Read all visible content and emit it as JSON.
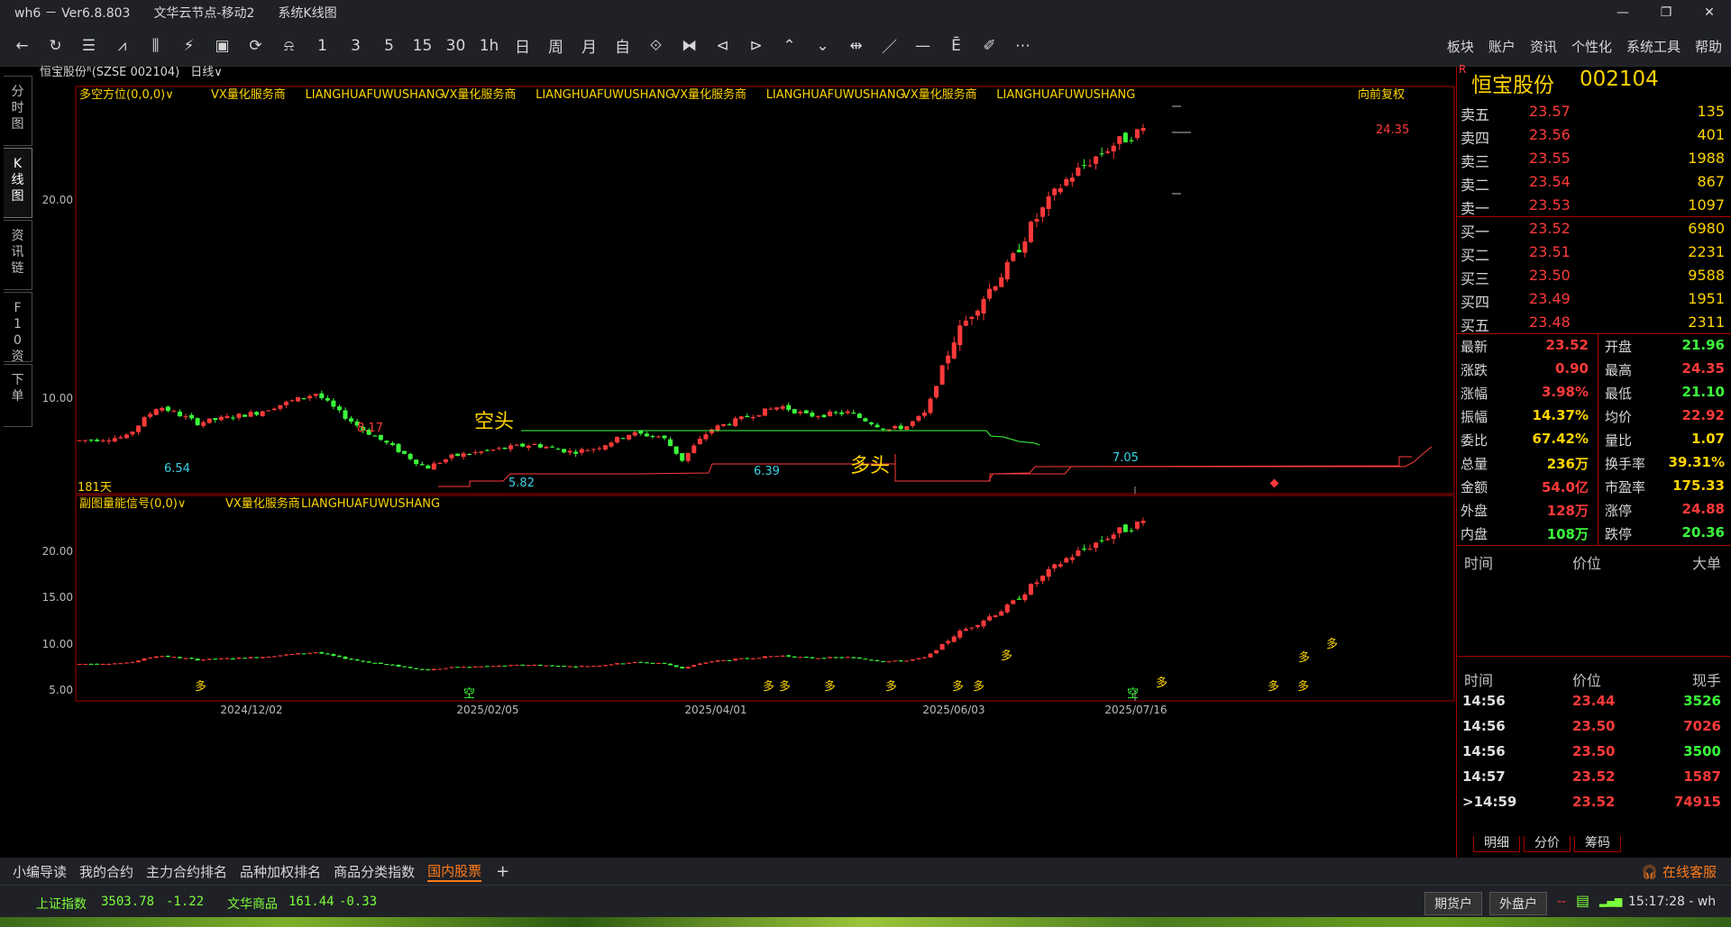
{
  "titlebar": {
    "app": "wh6 － Ver6.8.803",
    "node": "文华云节点-移动2",
    "view": "系统K线图",
    "ctrls": [
      "—",
      "❐",
      "✕"
    ]
  },
  "toolbar": {
    "icons": [
      "←",
      "↻",
      "☰",
      "⩘",
      "⫼",
      "⚡",
      "▣",
      "⟳",
      "⍾",
      "1",
      "3",
      "5",
      "15",
      "30",
      "1h",
      "日",
      "周",
      "月",
      "自",
      "⟐",
      "⧓",
      "⊲",
      "⊳",
      "⌃",
      "⌄",
      "⇹",
      "／",
      "—",
      "Ē",
      "✐",
      "⋯"
    ],
    "menu": [
      "板块",
      "账户",
      "资讯",
      "个性化",
      "系统工具",
      "帮助"
    ]
  },
  "sidetabs": [
    "分时图",
    "K线图",
    "资讯链",
    "F10资料",
    "下单"
  ],
  "chart": {
    "symbol_line": "恒宝股份ᴿ(SZSE 002104)",
    "period": "日线",
    "main_indicator": "多空方位(0,0,0)",
    "main_tags": [
      "VX量化服务商",
      "LIANGHUAFUWUSHANG",
      "VX量化服务商",
      "LIANGHUAFUWUSHANG",
      "VX量化服务商",
      "LIANGHUAFUWUSHANG",
      "VX量化服务商",
      "LIANGHUAFUWUSHANG"
    ],
    "adjust": "向前复权",
    "days": "181天",
    "main_yticks": [
      "20.00",
      "10.00"
    ],
    "sub_indicator": "副图量能信号(0,0)",
    "sub_tags": [
      "VX量化服务商",
      "LIANGHUAFUWUSHANG"
    ],
    "sub_yticks": [
      "20.00",
      "15.00",
      "10.00",
      "5.00"
    ],
    "dates": [
      "2024/12/02",
      "2025/02/05",
      "2025/04/01",
      "2025/06/03",
      "2025/07/16"
    ],
    "annotations": {
      "kong": "空头",
      "duo": "多头",
      "p1": "6.54",
      "p2": "8.17",
      "p3": "5.82",
      "p4": "6.39",
      "p5": "7.05",
      "p6": "24.35"
    },
    "signals": {
      "duo": "多",
      "kong": "空"
    }
  },
  "chart_data": {
    "type": "candlestick",
    "title": "恒宝股份(SZSE 002104) 日线",
    "x_range": [
      "2024/11",
      "2025/07/16"
    ],
    "marked_points": [
      {
        "label": "6.54"
      },
      {
        "label": "8.17"
      },
      {
        "label": "5.82"
      },
      {
        "label": "6.39"
      },
      {
        "label": "7.05"
      },
      {
        "label": "24.35"
      }
    ],
    "main_ylim": [
      5.5,
      26
    ],
    "sub_ylim": [
      4,
      26
    ]
  },
  "quote": {
    "name": "恒宝股份",
    "code": "002104",
    "asks": [
      {
        "l": "卖五",
        "p": "23.57",
        "v": "135"
      },
      {
        "l": "卖四",
        "p": "23.56",
        "v": "401"
      },
      {
        "l": "卖三",
        "p": "23.55",
        "v": "1988"
      },
      {
        "l": "卖二",
        "p": "23.54",
        "v": "867"
      },
      {
        "l": "卖一",
        "p": "23.53",
        "v": "1097"
      }
    ],
    "bids": [
      {
        "l": "买一",
        "p": "23.52",
        "v": "6980"
      },
      {
        "l": "买二",
        "p": "23.51",
        "v": "2231"
      },
      {
        "l": "买三",
        "p": "23.50",
        "v": "9588"
      },
      {
        "l": "买四",
        "p": "23.49",
        "v": "1951"
      },
      {
        "l": "买五",
        "p": "23.48",
        "v": "2311"
      }
    ],
    "stats": [
      {
        "a": "最新",
        "av": "23.52",
        "ac": "#ff3a3a",
        "b": "开盘",
        "bv": "21.96",
        "bc": "#3cff3c"
      },
      {
        "a": "涨跌",
        "av": "0.90",
        "ac": "#ff3a3a",
        "b": "最高",
        "bv": "24.35",
        "bc": "#ff3a3a"
      },
      {
        "a": "涨幅",
        "av": "3.98%",
        "ac": "#ff3a3a",
        "b": "最低",
        "bv": "21.10",
        "bc": "#3cff3c"
      },
      {
        "a": "振幅",
        "av": "14.37%",
        "ac": "#ffd400",
        "b": "均价",
        "bv": "22.92",
        "bc": "#ff3a3a"
      },
      {
        "a": "委比",
        "av": "67.42%",
        "ac": "#ffd400",
        "b": "量比",
        "bv": "1.07",
        "bc": "#ffd400"
      },
      {
        "a": "总量",
        "av": "236万",
        "ac": "#ffd400",
        "b": "换手率",
        "bv": "39.31%",
        "bc": "#ffd400"
      },
      {
        "a": "金额",
        "av": "54.0亿",
        "ac": "#ff3a3a",
        "b": "市盈率",
        "bv": "175.33",
        "bc": "#ffd400"
      },
      {
        "a": "外盘",
        "av": "128万",
        "ac": "#ff3a3a",
        "b": "涨停",
        "bv": "24.88",
        "bc": "#ff3a3a"
      },
      {
        "a": "内盘",
        "av": "108万",
        "ac": "#3cff3c",
        "b": "跌停",
        "bv": "20.36",
        "bc": "#3cff3c"
      }
    ],
    "big_hdr": [
      "时间",
      "价位",
      "大单"
    ],
    "tick_hdr": [
      "时间",
      "价位",
      "现手"
    ],
    "ticks": [
      {
        "t": "14:56",
        "p": "23.44",
        "v": "3526",
        "vc": "#3cff3c"
      },
      {
        "t": "14:56",
        "p": "23.50",
        "v": "7026",
        "vc": "#ff3a3a"
      },
      {
        "t": "14:56",
        "p": "23.50",
        "v": "3500",
        "vc": "#3cff3c"
      },
      {
        "t": "14:57",
        "p": "23.52",
        "v": "1587",
        "vc": "#ff3a3a"
      },
      {
        "t": ">14:59",
        "p": "23.52",
        "v": "74915",
        "vc": "#ff3a3a"
      }
    ],
    "tabs": [
      "明细",
      "分价",
      "筹码"
    ]
  },
  "bottombar": {
    "tabs": [
      "小编导读",
      "我的合约",
      "主力合约排名",
      "品种加权排名",
      "商品分类指数",
      "国内股票"
    ],
    "add": "+",
    "service": "在线客服"
  },
  "statusbar": {
    "idx1_name": "上证指数",
    "idx1_val": "3503.78",
    "idx1_chg": "-1.22",
    "idx2_name": "文华商品",
    "idx2_val": "161.44",
    "idx2_chg": "-0.33",
    "btn1": "期货户",
    "btn2": "外盘户",
    "dash": "--",
    "time": "15:17:28 - wh"
  },
  "colors": {
    "up": "#ff3a3a",
    "down": "#3cff3c",
    "accent": "#ffd400",
    "orange": "#ff7a1a",
    "frame": "#aa0000"
  }
}
